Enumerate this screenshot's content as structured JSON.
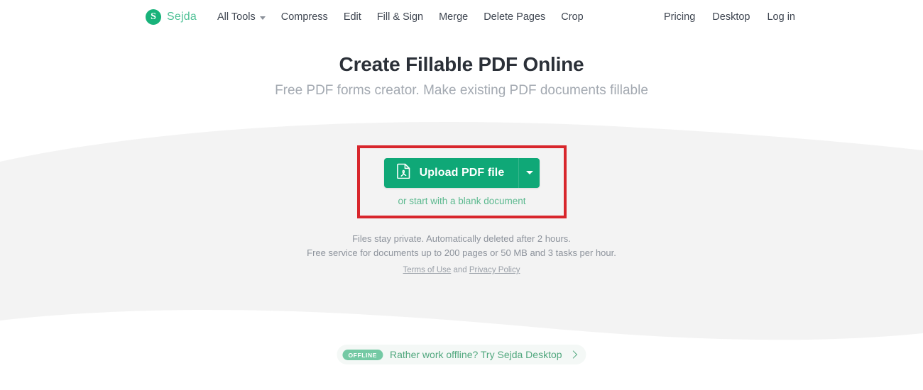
{
  "colors": {
    "brand_green": "#18b27a",
    "button_green": "#0fa877",
    "link_green": "#5cb98f",
    "highlight_red": "#d8262c",
    "band_grey": "#f3f3f3",
    "heading": "#2b3038",
    "subheading": "#a3a9b1"
  },
  "navbar": {
    "brand": {
      "mark": "S",
      "name": "Sejda",
      "logo_icon": "sejda-circle-logo"
    },
    "left_links": [
      {
        "label": "All Tools",
        "has_caret": true
      },
      {
        "label": "Compress",
        "has_caret": false
      },
      {
        "label": "Edit",
        "has_caret": false
      },
      {
        "label": "Fill & Sign",
        "has_caret": false
      },
      {
        "label": "Merge",
        "has_caret": false
      },
      {
        "label": "Delete Pages",
        "has_caret": false
      },
      {
        "label": "Crop",
        "has_caret": false
      }
    ],
    "right_links": [
      {
        "label": "Pricing"
      },
      {
        "label": "Desktop"
      },
      {
        "label": "Log in"
      }
    ]
  },
  "hero": {
    "title": "Create Fillable PDF Online",
    "subtitle": "Free PDF forms creator. Make existing PDF documents fillable"
  },
  "upload": {
    "button_label": "Upload PDF file",
    "button_icon": "pdf-file-icon",
    "dropdown_icon": "caret-down-icon",
    "blank_document_link": "or start with a blank document",
    "highlighted": true
  },
  "fineprint": {
    "line1": "Files stay private. Automatically deleted after 2 hours.",
    "line2": "Free service for documents up to 200 pages or 50 MB and 3 tasks per hour.",
    "terms_label": "Terms of Use",
    "conjunction": " and ",
    "privacy_label": "Privacy Policy"
  },
  "offline_banner": {
    "badge": "OFFLINE",
    "text": "Rather work offline? Try Sejda Desktop",
    "chevron_icon": "chevron-right-icon"
  }
}
